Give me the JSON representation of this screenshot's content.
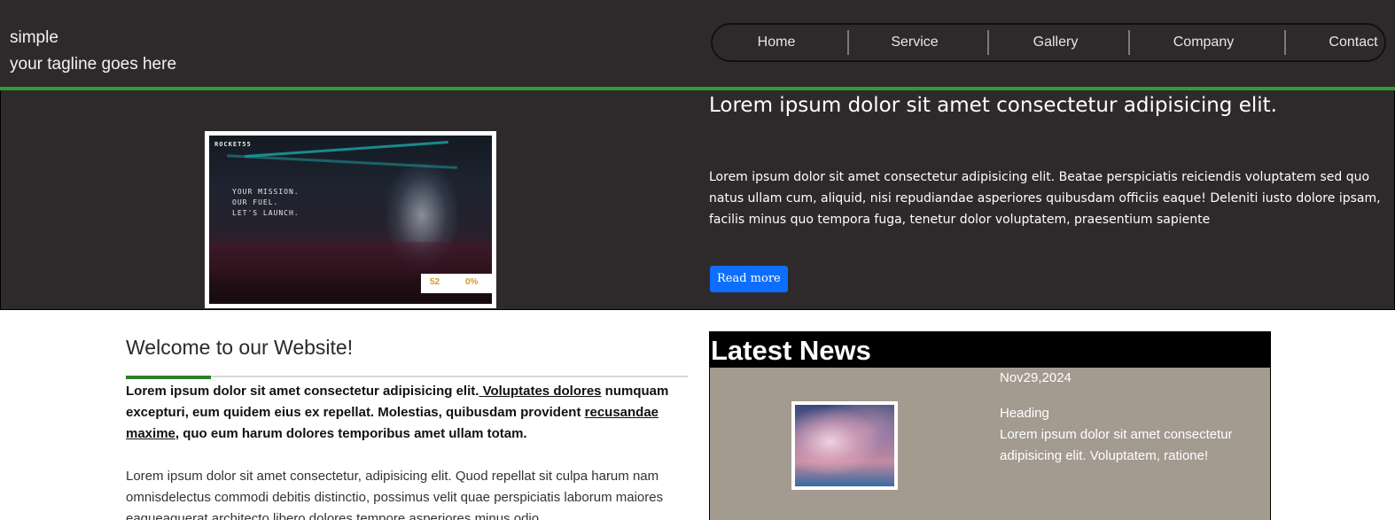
{
  "header": {
    "site_name": "simple",
    "tagline": "your tagline goes here",
    "nav": [
      "Home",
      "Service",
      "Gallery",
      "Company",
      "Contact"
    ]
  },
  "hero": {
    "image": {
      "logo": "ROCKET55",
      "mission_lines": [
        "YOUR MISSION.",
        "OUR FUEL.",
        "LET'S LAUNCH."
      ],
      "stat_1": "52",
      "stat_2": "0%"
    },
    "title": "Lorem ipsum dolor sit amet consectetur adipisicing elit.",
    "text": "Lorem ipsum dolor sit amet consectetur adipisicing elit. Beatae perspiciatis reiciendis voluptatem sed quo natus ullam cum, aliquid, nisi repudiandae asperiores quibusdam officiis eaque! Deleniti iusto dolore ipsam, facilis minus quo tempora fuga, tenetur dolor voluptatem, praesentium sapiente",
    "button": "Read more"
  },
  "welcome": {
    "title": "Welcome to our Website!",
    "lead_start": "Lorem ipsum dolor sit amet consectetur adipisicing elit.",
    "lead_link_1": " Voluptates dolores",
    "lead_middle": " numquam excepturi, eum quidem eius ex repellat. Molestias, quibusdam provident ",
    "lead_link_2": "recusandae maxime",
    "lead_end": ", quo eum harum dolores temporibus amet ullam totam.",
    "body": "Lorem ipsum dolor sit amet consectetur, adipisicing elit. Quod repellat sit culpa harum nam omnisdelectus commodi debitis distinctio, possimus velit quae perspiciatis laborum maiores eaqueaquerat architecto libero dolores tempore asperiores minus odio."
  },
  "news": {
    "title": "Latest News",
    "date": "Nov29,2024",
    "heading": "Heading",
    "text": "Lorem ipsum dolor sit amet consectetur adipisicing elit. Voluptatem, ratione!"
  },
  "colors": {
    "header_bg": "#2e2a2b",
    "accent_green": "#2f9d2f",
    "button_blue": "#0d6efd",
    "news_bg": "#a39a90"
  }
}
